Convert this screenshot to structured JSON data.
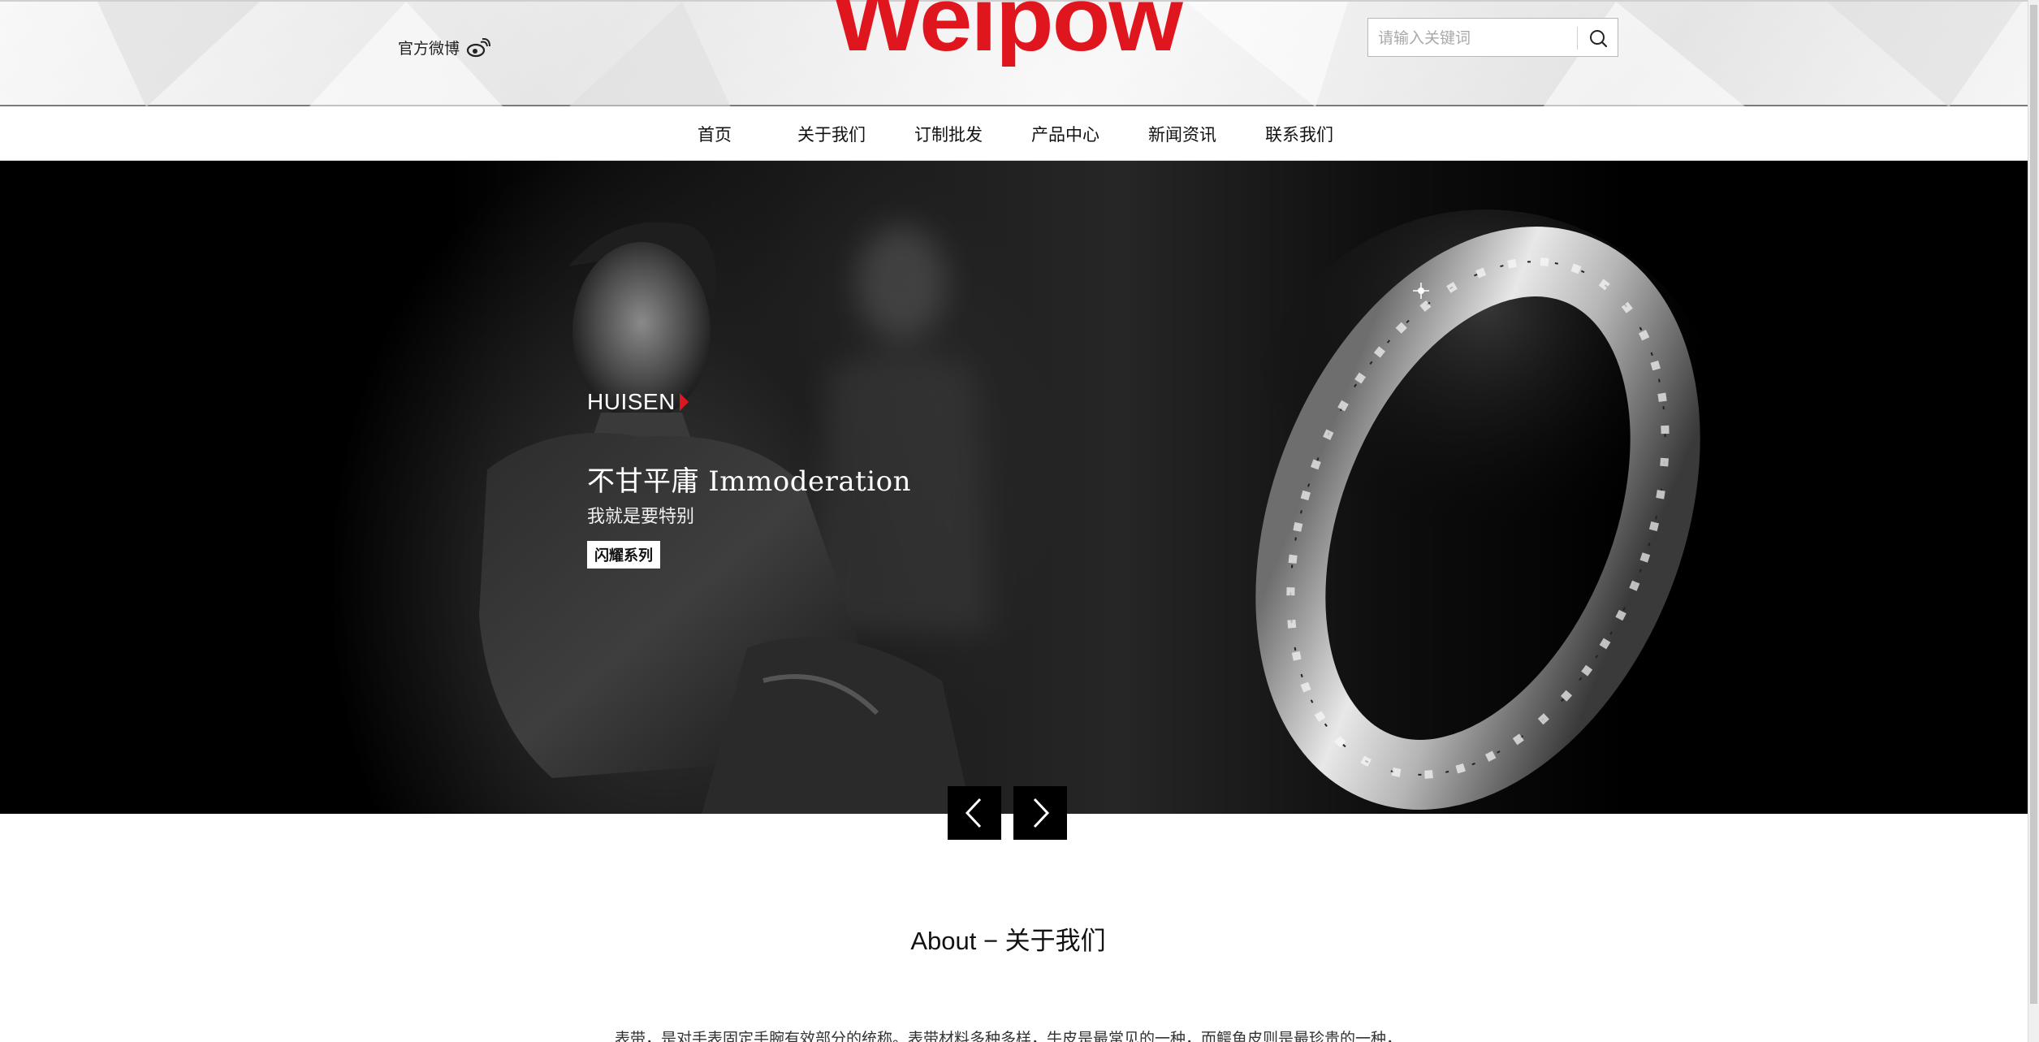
{
  "header": {
    "weibo_label": "官方微博",
    "logo_text": "Weipow",
    "search": {
      "placeholder": "请输入关键词",
      "value": ""
    }
  },
  "nav": {
    "items": [
      {
        "label": "首页"
      },
      {
        "label": "关于我们"
      },
      {
        "label": "订制批发"
      },
      {
        "label": "产品中心"
      },
      {
        "label": "新闻资讯"
      },
      {
        "label": "联系我们"
      }
    ]
  },
  "banner": {
    "brand": "HUISEN",
    "headline": "不甘平庸 Immoderation",
    "subline": "我就是要特别",
    "series_button": "闪耀系列",
    "prev_icon": "chevron-left-icon",
    "next_icon": "chevron-right-icon"
  },
  "about": {
    "title": "About − 关于我们",
    "text": "表带，是对手表固定手腕有效部分的统称。表带材料多种多样，牛皮是最常见的一种，而鳄鱼皮则是最珍贵的一种，"
  },
  "colors": {
    "brand_red": "#e0161e",
    "banner_bg": "#000000",
    "nav_bg": "#ffffff"
  }
}
